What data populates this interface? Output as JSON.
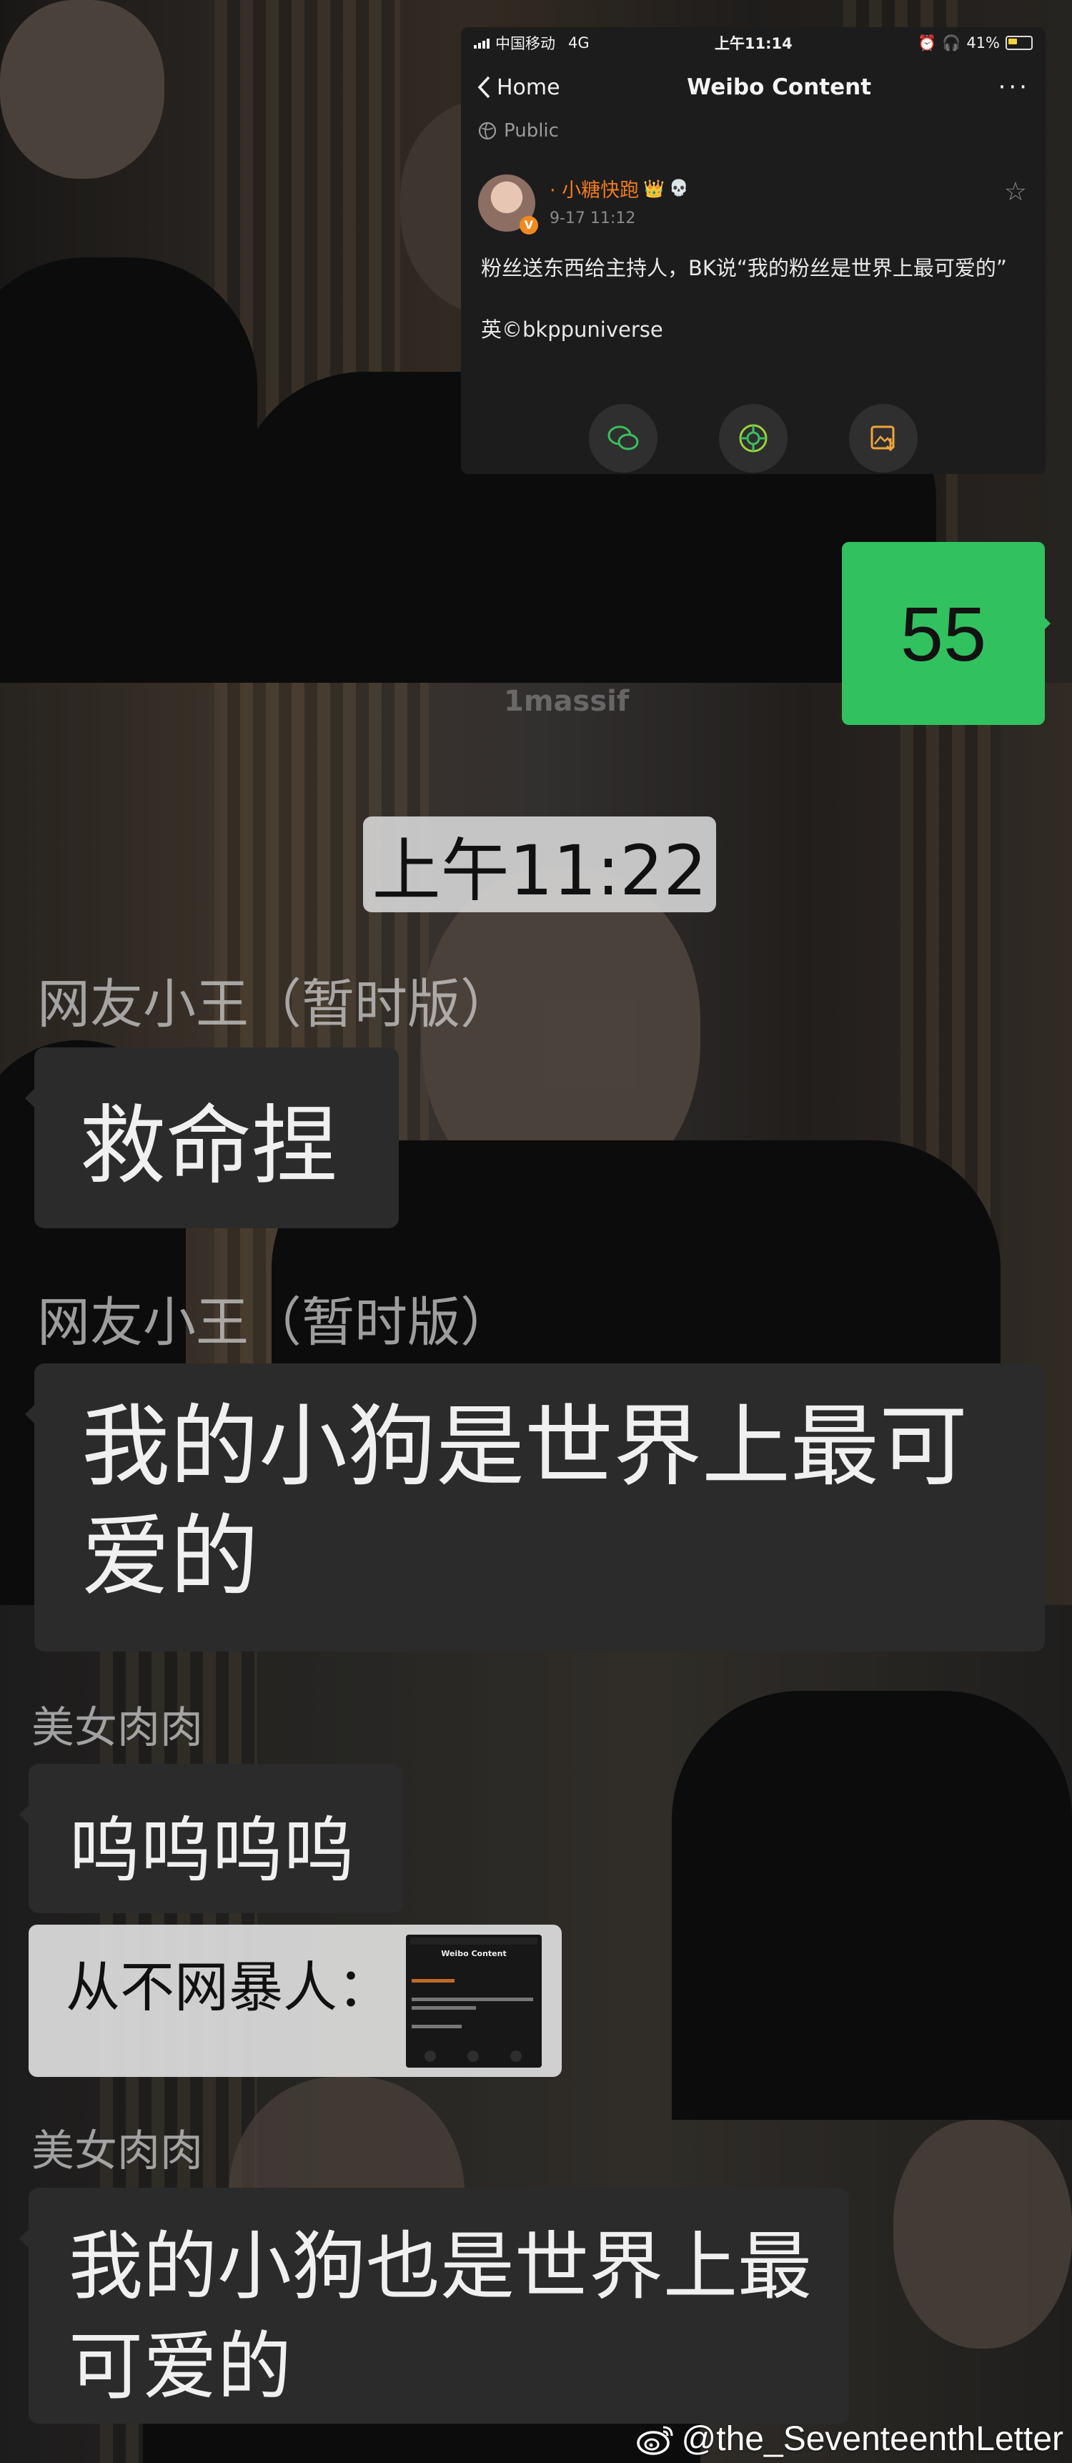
{
  "weibo": {
    "status_bar": {
      "carrier": "中国移动",
      "network": "4G",
      "time": "上午11:14",
      "battery": "41%"
    },
    "nav": {
      "back_label": "Home",
      "title": "Weibo Content",
      "more": "···"
    },
    "visibility": "Public",
    "post": {
      "username": "· 小糖快跑",
      "verified_badge": "V",
      "date": "9-17 11:12",
      "text": "粉丝送东西给主持人，BK说“我的粉丝是世界上最可爱的”",
      "credit": "英©bkppuniverse"
    },
    "share_icons": [
      "wechat-icon",
      "moments-icon",
      "save-image-icon"
    ]
  },
  "chat": {
    "green_bubble": "55",
    "watermark": "1massif",
    "timestamp": "上午11:22",
    "messages": [
      {
        "sender": "网友小王（暂时版）",
        "text": "救命捏"
      },
      {
        "sender": "网友小王（暂时版）",
        "text": "我的小狗是世界上最可爱的"
      },
      {
        "sender": "美女肉肉",
        "text": "呜呜呜呜"
      },
      {
        "sender": "",
        "text": "从不网暴人："
      },
      {
        "sender": "美女肉肉",
        "text": "我的小狗也是世界上最可爱的"
      }
    ],
    "quote_thumbnail_title": "Weibo Content"
  },
  "credit": {
    "handle": "@the_SeventeenthLetter",
    "icon": "weibo-logo-icon"
  },
  "colors": {
    "green_bubble": "#32c15f",
    "dark_bubble": "#2b2b2b",
    "weibo_orange": "#f07b21"
  }
}
